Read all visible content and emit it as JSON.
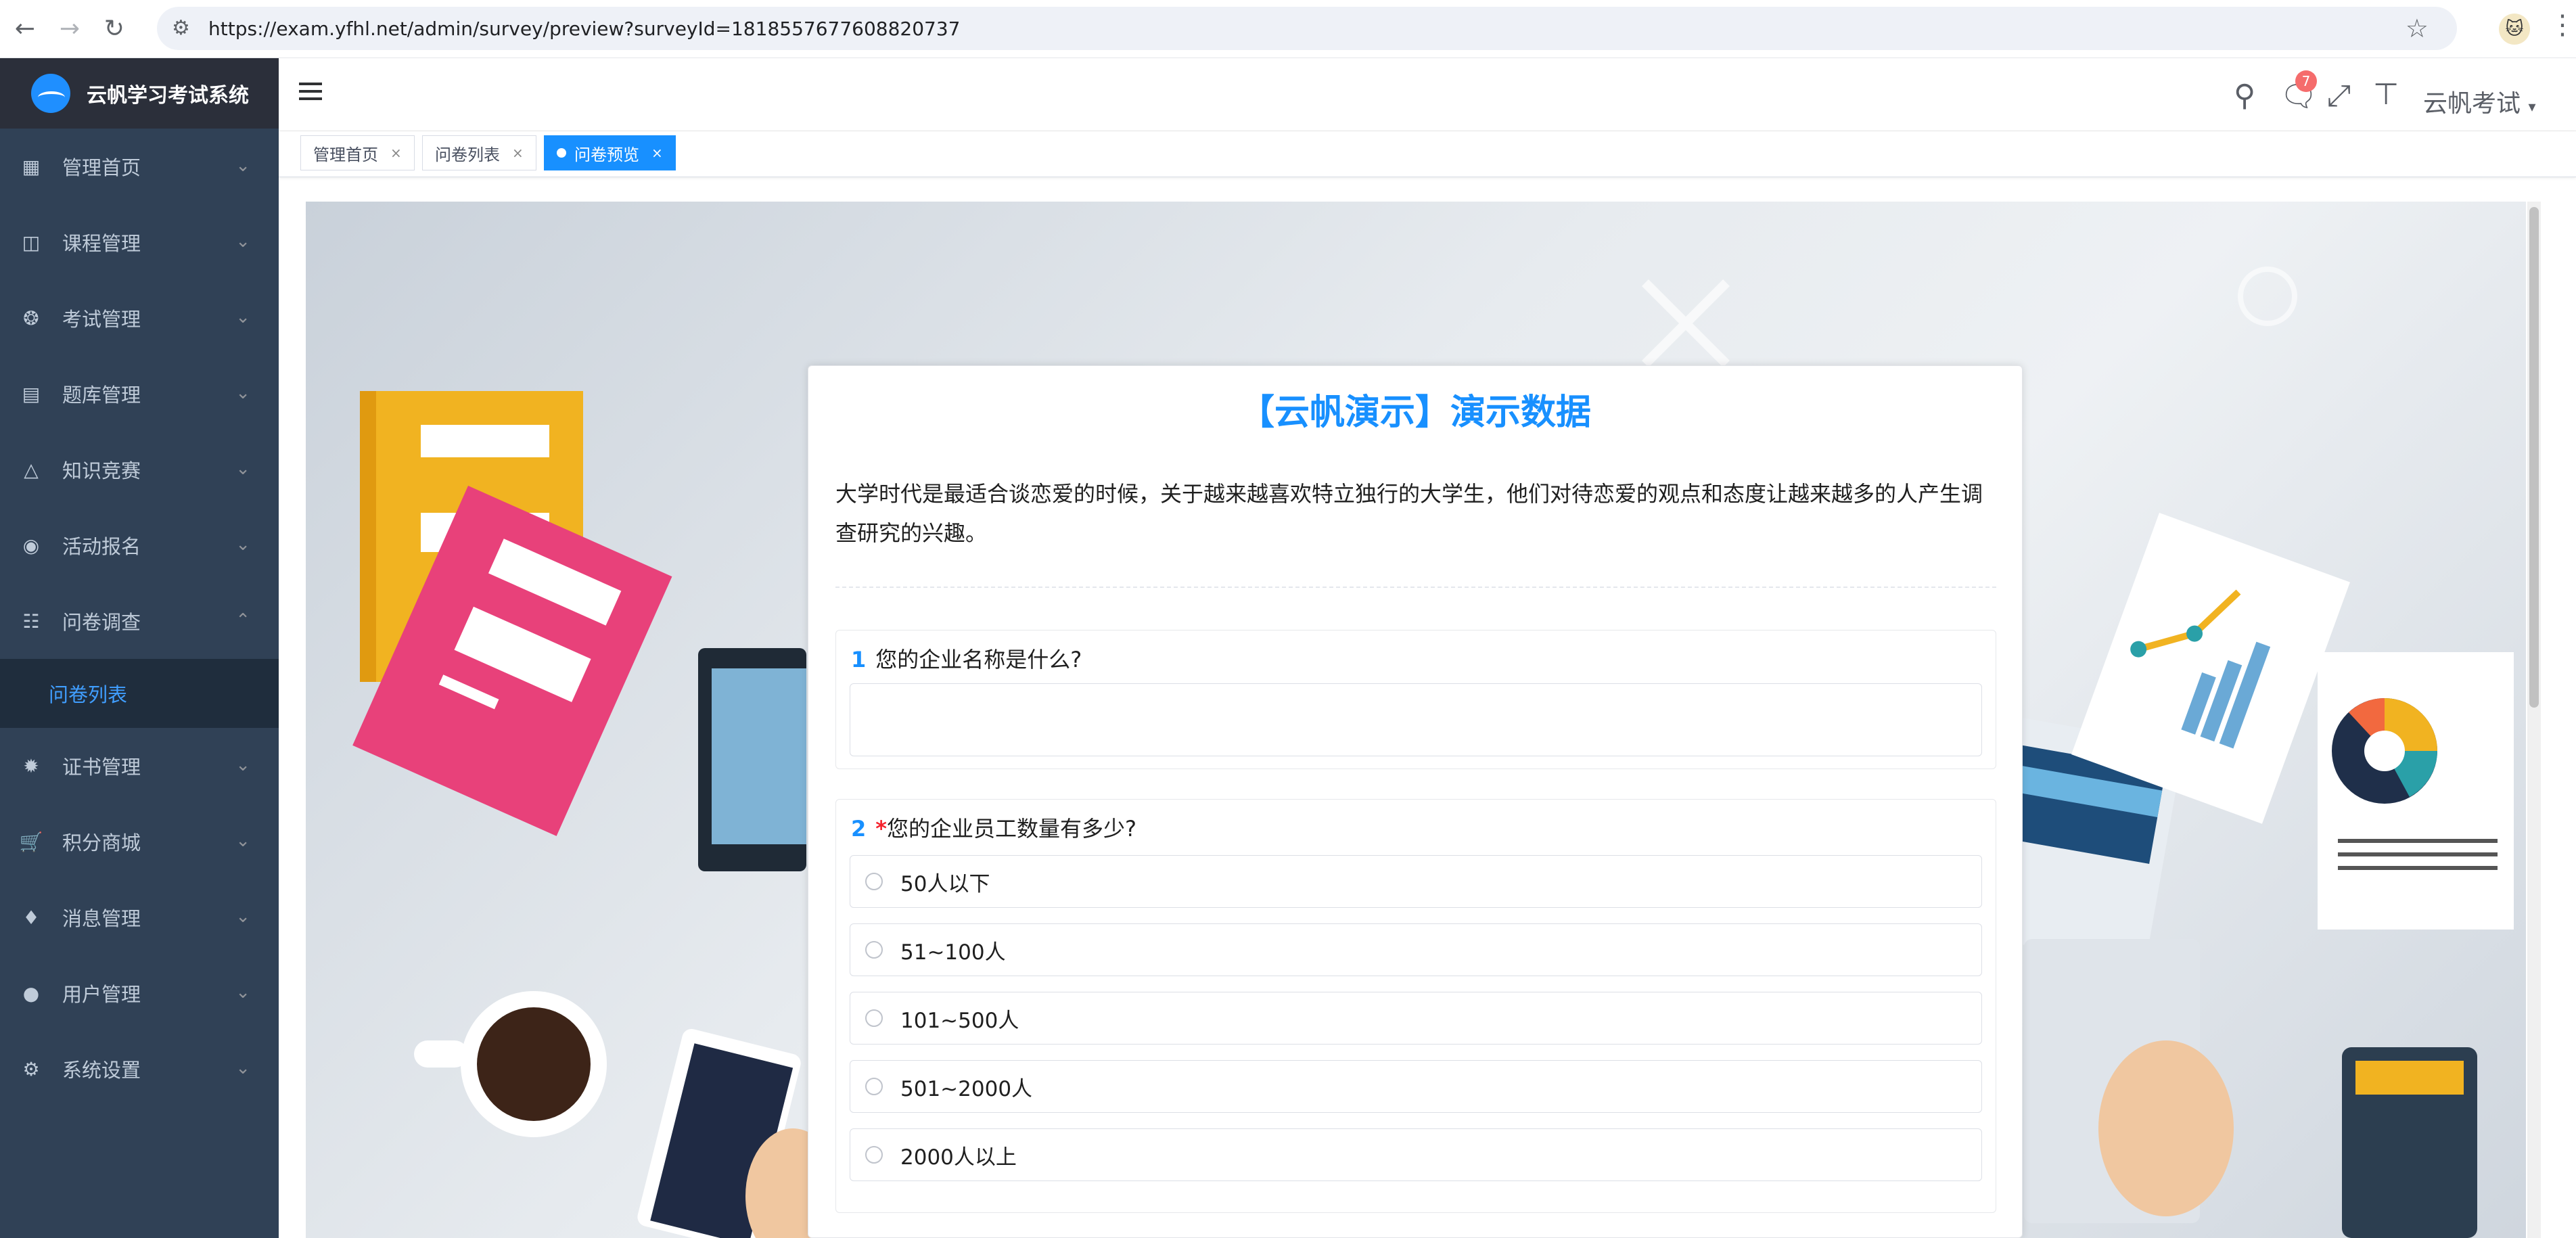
{
  "browser": {
    "url": "https://exam.yfhl.net/admin/survey/preview?surveyId=1818557677608820737"
  },
  "sidebar": {
    "app_title": "云帆学习考试系统",
    "items": [
      {
        "label": "管理首页",
        "icon": "dashboard-icon"
      },
      {
        "label": "课程管理",
        "icon": "course-icon"
      },
      {
        "label": "考试管理",
        "icon": "exam-icon"
      },
      {
        "label": "题库管理",
        "icon": "question-bank-icon"
      },
      {
        "label": "知识竞赛",
        "icon": "fire-icon"
      },
      {
        "label": "活动报名",
        "icon": "activity-icon"
      },
      {
        "label": "问卷调查",
        "icon": "survey-icon"
      },
      {
        "label": "证书管理",
        "icon": "certificate-icon"
      },
      {
        "label": "积分商城",
        "icon": "cart-icon"
      },
      {
        "label": "消息管理",
        "icon": "bell-icon"
      },
      {
        "label": "用户管理",
        "icon": "user-icon"
      },
      {
        "label": "系统设置",
        "icon": "gear-icon"
      }
    ],
    "submenu_label": "问卷列表"
  },
  "header": {
    "badge_count": "7",
    "user_name": "云帆考试"
  },
  "tags": [
    {
      "label": "管理首页"
    },
    {
      "label": "问卷列表"
    },
    {
      "label": "问卷预览"
    }
  ],
  "survey": {
    "title": "【云帆演示】演示数据",
    "description": "大学时代是最适合谈恋爱的时候，关于越来越喜欢特立独行的大学生，他们对待恋爱的观点和态度让越来越多的人产生调查研究的兴趣。",
    "q1": {
      "number": "1",
      "text": "您的企业名称是什么?"
    },
    "q2": {
      "number": "2",
      "required_mark": "*",
      "text": "您的企业员工数量有多少?",
      "options": [
        "50人以下",
        "51~100人",
        "101~500人",
        "501~2000人",
        "2000人以上"
      ]
    }
  },
  "colors": {
    "sidebar_bg": "#304156",
    "accent": "#1890ff",
    "badge": "#f56c6c"
  }
}
